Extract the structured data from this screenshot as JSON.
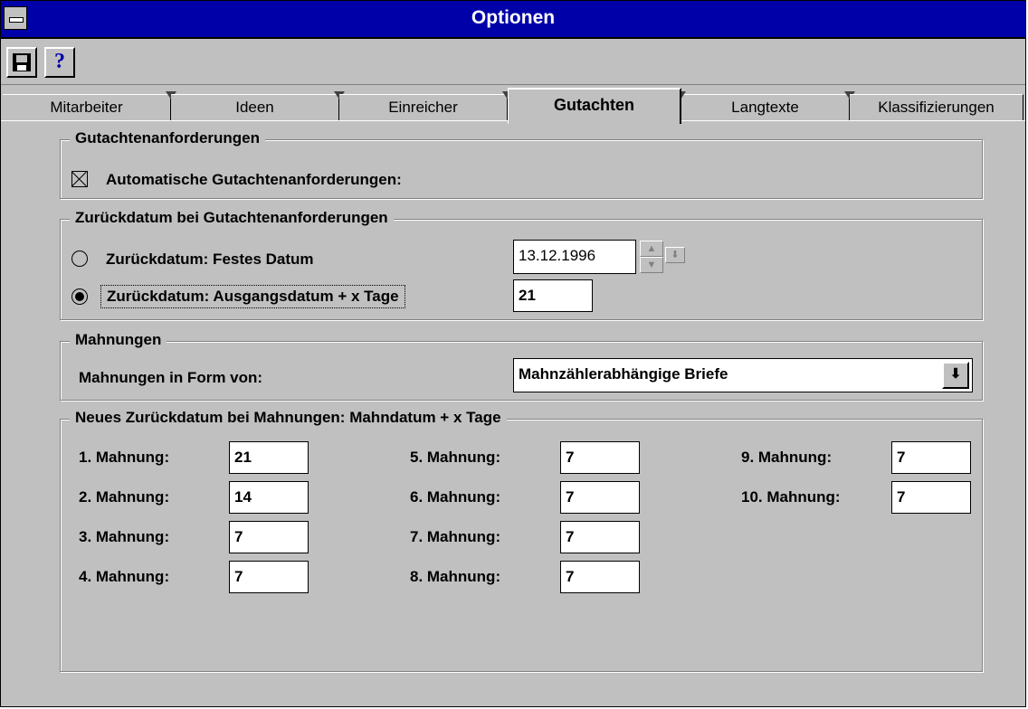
{
  "window": {
    "title": "Optionen"
  },
  "toolbar": {
    "save_icon": "floppy-disk-icon",
    "help_label": "?"
  },
  "tabs": [
    {
      "label": "Mitarbeiter",
      "active": false
    },
    {
      "label": "Ideen",
      "active": false
    },
    {
      "label": "Einreicher",
      "active": false
    },
    {
      "label": "Gutachten",
      "active": true
    },
    {
      "label": "Langtexte",
      "active": false
    },
    {
      "label": "Klassifizierungen",
      "active": false
    }
  ],
  "gutachtenanforderungen": {
    "title": "Gutachtenanforderungen",
    "auto_label": "Automatische Gutachtenanforderungen:",
    "auto_checked": true
  },
  "zurueckdatum": {
    "title": "Zurückdatum bei Gutachtenanforderungen",
    "fixed_label": "Zurückdatum: Festes Datum",
    "fixed_value": "13.12.1996",
    "relative_label": "Zurückdatum: Ausgangsdatum + x Tage",
    "relative_value": "21",
    "selected": "relative"
  },
  "mahnungen": {
    "title": "Mahnungen",
    "form_label": "Mahnungen in Form von:",
    "form_value": "Mahnzählerabhängige Briefe"
  },
  "neues_datum": {
    "title": "Neues Zurückdatum bei Mahnungen: Mahndatum + x Tage",
    "items": [
      {
        "label": "1. Mahnung:",
        "value": "21"
      },
      {
        "label": "2. Mahnung:",
        "value": "14"
      },
      {
        "label": "3. Mahnung:",
        "value": "7"
      },
      {
        "label": "4. Mahnung:",
        "value": "7"
      },
      {
        "label": "5. Mahnung:",
        "value": "7"
      },
      {
        "label": "6. Mahnung:",
        "value": "7"
      },
      {
        "label": "7. Mahnung:",
        "value": "7"
      },
      {
        "label": "8. Mahnung:",
        "value": "7"
      },
      {
        "label": "9. Mahnung:",
        "value": "7"
      },
      {
        "label": "10. Mahnung:",
        "value": "7"
      }
    ]
  }
}
